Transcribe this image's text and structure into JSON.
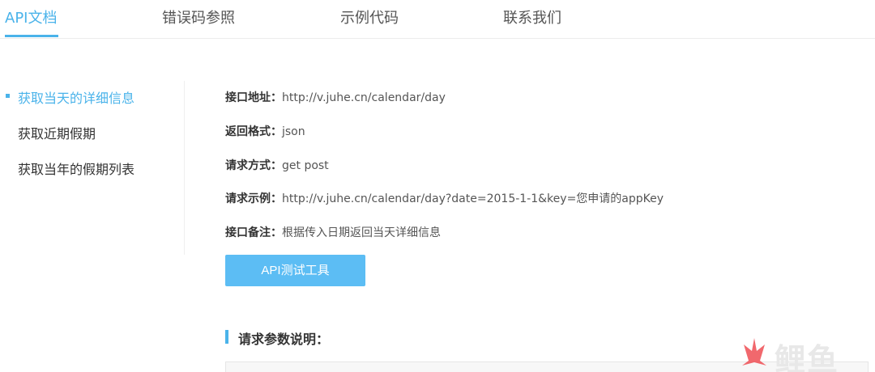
{
  "tabs": [
    {
      "label": "API文档",
      "active": true
    },
    {
      "label": "错误码参照",
      "active": false
    },
    {
      "label": "示例代码",
      "active": false
    },
    {
      "label": "联系我们",
      "active": false
    }
  ],
  "sidebar": {
    "items": [
      {
        "label": "获取当天的详细信息",
        "active": true
      },
      {
        "label": "获取近期假期",
        "active": false
      },
      {
        "label": "获取当年的假期列表",
        "active": false
      }
    ]
  },
  "api_info": [
    {
      "label": "接口地址：",
      "value": "http://v.juhe.cn/calendar/day"
    },
    {
      "label": "返回格式：",
      "value": "json"
    },
    {
      "label": "请求方式：",
      "value": "get post"
    },
    {
      "label": "请求示例：",
      "value": "http://v.juhe.cn/calendar/day?date=2015-1-1&key=您申请的appKey"
    },
    {
      "label": "接口备注：",
      "value": "根据传入日期返回当天详细信息"
    }
  ],
  "test_button_label": "API测试工具",
  "section_title": "请求参数说明：",
  "watermark": {
    "text": "鲤鱼"
  },
  "colors": {
    "accent": "#4ab3ea",
    "button": "#5cbdf4",
    "watermark_flame": "#ef4e54"
  }
}
